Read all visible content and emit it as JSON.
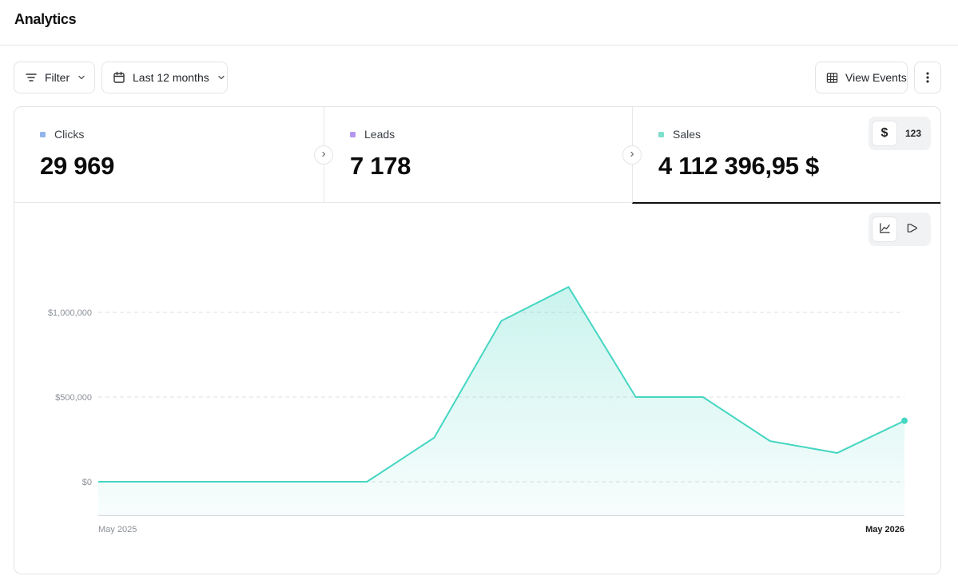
{
  "header": {
    "title": "Analytics"
  },
  "toolbar": {
    "filter_label": "Filter",
    "date_label": "Last 12 months",
    "events_label": "View Events"
  },
  "metrics": [
    {
      "label": "Clicks",
      "value": "29 969",
      "color": "#93b4ec"
    },
    {
      "label": "Leads",
      "value": "7 178",
      "color": "#b497ec"
    },
    {
      "label": "Sales",
      "value": "4 112 396,95 $",
      "color": "#7fe0cc"
    }
  ],
  "unit_toggle": {
    "currency": "$",
    "number": "123",
    "selected": "$"
  },
  "chart_toggle": {
    "options": [
      "line-chart-icon",
      "funnel-icon"
    ],
    "selected": "line-chart-icon"
  },
  "colors": {
    "accent": "#45d6c2",
    "active_tab_border": "#111111"
  },
  "chart_data": {
    "type": "area",
    "title": "",
    "xlabel": "",
    "ylabel": "",
    "x": [
      "2025-05",
      "2025-06",
      "2025-07",
      "2025-08",
      "2025-09",
      "2025-10",
      "2025-11",
      "2025-12",
      "2026-01",
      "2026-02",
      "2026-03",
      "2026-04",
      "2026-05"
    ],
    "series": [
      {
        "values": [
          0,
          0,
          0,
          0,
          0,
          260000,
          950000,
          1150000,
          500000,
          500000,
          240000,
          170000,
          360000
        ]
      }
    ],
    "ylim": [
      -200000,
      1200000
    ],
    "yticks": [
      0,
      500000,
      1000000
    ],
    "ytick_labels": [
      "$0",
      "$500,000",
      "$1,000,000"
    ],
    "xtick_labels": [
      "May 2025",
      "May 2026"
    ],
    "grid": "dashed-horizontal",
    "last_point_marker": true,
    "color": "#45d6c2"
  }
}
